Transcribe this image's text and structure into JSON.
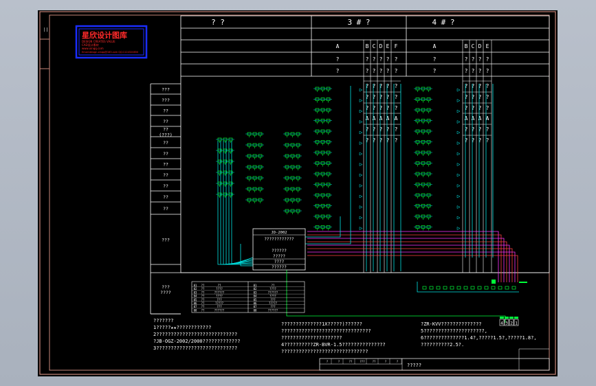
{
  "logo": {
    "title": "星欣设计图库",
    "line1": "DESIGN CREATES VALUE",
    "line2": "CAD设计素材",
    "line3": "www.xinqq.com",
    "line4": "Email:design.xinqq@163.com QQ:1124320850"
  },
  "header": {
    "col_a_title": "? ?",
    "col_3_title": "3 # ?",
    "col_4_title": "4 # ?"
  },
  "column_letters_3": [
    "A",
    "B",
    "C",
    "D",
    "E",
    "F"
  ],
  "column_letters_4": [
    "A",
    "B",
    "C",
    "D",
    "E"
  ],
  "value_rows_3": [
    [
      "?",
      "?",
      "?",
      "?",
      "?",
      "?"
    ],
    [
      "?",
      "?",
      "?",
      "?",
      "?",
      "?"
    ],
    [
      "",
      "?",
      "?",
      "?",
      "?",
      "?"
    ],
    [
      "",
      "?",
      "?",
      "?",
      "?",
      "?"
    ],
    [
      "",
      "?",
      "?",
      "?",
      "?",
      "?"
    ],
    [
      "",
      "A",
      "A",
      "A",
      "A",
      "A"
    ],
    [
      "",
      "?",
      "?",
      "?",
      "?",
      "?"
    ],
    [
      "",
      "?",
      "?",
      "?",
      "?",
      "?"
    ]
  ],
  "value_rows_4": [
    [
      "?",
      "?",
      "?",
      "?",
      "?"
    ],
    [
      "?",
      "?",
      "?",
      "?",
      "?"
    ],
    [
      "",
      "?",
      "?",
      "?",
      "?"
    ],
    [
      "",
      "?",
      "?",
      "?",
      "?"
    ],
    [
      "",
      "?",
      "?",
      "?",
      "?"
    ],
    [
      "",
      "A",
      "A",
      "A",
      "A"
    ],
    [
      "",
      "?",
      "?",
      "?",
      "?"
    ],
    [
      "",
      "?",
      "?",
      "?",
      "?"
    ]
  ],
  "row_labels": [
    "???",
    "???",
    "??",
    "??",
    "??\n(???)",
    "??",
    "??",
    "??",
    "??",
    "??",
    "??",
    "??",
    "???",
    "???\n????"
  ],
  "junction_box": {
    "title": "JD-2002",
    "lines": [
      "????????????",
      "??????",
      "?????",
      "????",
      "??????"
    ]
  },
  "legend": {
    "rows": [
      [
        "01",
        "??",
        "??",
        "01",
        "??"
      ],
      [
        "02",
        "??",
        "????",
        "02",
        "????"
      ],
      [
        "03",
        "??",
        "??????",
        "03",
        "??????"
      ],
      [
        "04",
        "??",
        "????",
        "04",
        "????"
      ],
      [
        "05",
        "??",
        "???",
        "05",
        "???"
      ],
      [
        "06",
        "??",
        "?????",
        "06",
        "?????"
      ],
      [
        "07",
        "??",
        "???",
        "07",
        "???"
      ],
      [
        "08",
        "??",
        "??????",
        "08",
        "??????"
      ]
    ]
  },
  "notes_left": [
    "???????",
    "1?????★★????????????",
    "2????????????????????????????",
    "?JB-OGZ-2002/2000?????????????",
    "3????????????????????????????"
  ],
  "notes_mid": [
    "??????????????1X?????)??????",
    "???????????????????????????????",
    "?????????????????????",
    "4??????????ZR-BVR-1.5???????????????",
    "??????????????????????????????"
  ],
  "notes_right": [
    "?ZR-KVV??????????????",
    "5?????????????????????,",
    "6??????????????1.4?,?????1.5?,?????1.8?,",
    "??????????2.5?."
  ],
  "device_tags": [
    "4",
    "3",
    "2",
    "1"
  ],
  "title_block": {
    "drawing_name": "?????",
    "cells": [
      "?",
      "?",
      "??",
      "???",
      "??",
      "?",
      "?"
    ]
  },
  "colors": {
    "frame": "#c9877a",
    "lines": "#ffffff",
    "wire_cyan": "#00e5e5",
    "wire_green": "#00ff3a",
    "wire_magenta": "#ff33ff",
    "wire_red": "#ff4040",
    "logo_border": "#1a2dff",
    "logo_text": "#ff2a2a"
  }
}
